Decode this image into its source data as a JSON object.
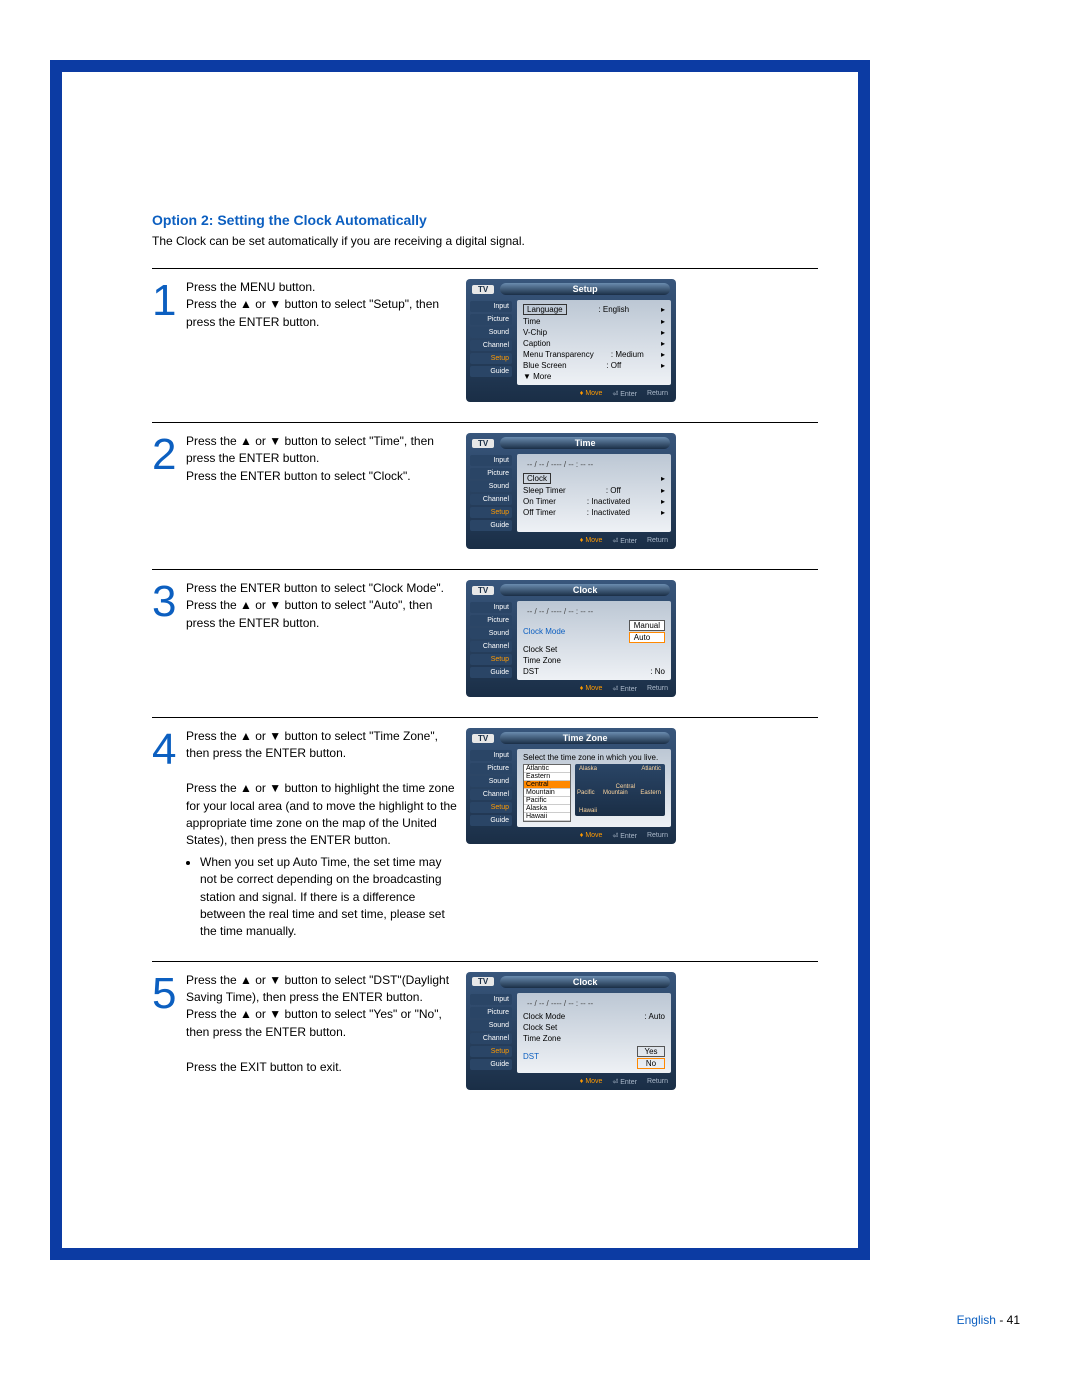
{
  "page": {
    "section_title": "Option 2: Setting the Clock Automatically",
    "intro": "The Clock can be set automatically if you are receiving a digital signal.",
    "footer": {
      "lang": "English",
      "page": "- 41"
    }
  },
  "sidebar_labels": [
    "Input",
    "Picture",
    "Sound",
    "Channel",
    "Setup",
    "Guide"
  ],
  "osd_foot": {
    "move": "Move",
    "enter": "Enter",
    "return": "Return"
  },
  "common": {
    "tv": "TV",
    "time_placeholder": "-- / -- / ---- / -- : -- --"
  },
  "steps": [
    {
      "num": "1",
      "text_parts": [
        "Press the MENU button.",
        "Press the ▲ or ▼ button to select \"Setup\", then press the ENTER button."
      ],
      "osd": {
        "title": "Setup",
        "rows": [
          {
            "label": "Language",
            "value": ": English",
            "boxed": true,
            "arrow": true
          },
          {
            "label": "Time",
            "value": "",
            "arrow": true
          },
          {
            "label": "V-Chip",
            "value": "",
            "arrow": true
          },
          {
            "label": "Caption",
            "value": "",
            "arrow": true
          },
          {
            "label": "Menu Transparency",
            "value": ": Medium",
            "arrow": true
          },
          {
            "label": "Blue Screen",
            "value": ": Off",
            "arrow": true
          },
          {
            "label": "▼ More",
            "value": "",
            "arrow": false
          }
        ]
      }
    },
    {
      "num": "2",
      "text_parts": [
        "Press the ▲ or ▼ button to select \"Time\", then press the ENTER button.",
        "Press the ENTER button to select \"Clock\"."
      ],
      "osd": {
        "title": "Time",
        "timeline": "-- / -- / ---- / -- : -- --",
        "rows": [
          {
            "label": "Clock",
            "value": "",
            "boxed": true,
            "arrow": true
          },
          {
            "label": "Sleep Timer",
            "value": ": Off",
            "arrow": true
          },
          {
            "label": "On Timer",
            "value": ": Inactivated",
            "arrow": true
          },
          {
            "label": "Off Timer",
            "value": ": Inactivated",
            "arrow": true
          }
        ]
      }
    },
    {
      "num": "3",
      "text_parts": [
        "Press the ENTER button to select \"Clock Mode\".",
        "Press the ▲ or ▼ button to select \"Auto\", then press the ENTER button."
      ],
      "osd": {
        "title": "Clock",
        "timeline": "-- / -- / ---- / -- : -- --",
        "clockmode": {
          "label": "Clock Mode",
          "options": [
            "Manual",
            "Auto"
          ],
          "selected": "Auto"
        },
        "extra_rows": [
          {
            "label": "Clock Set",
            "value": ""
          },
          {
            "label": "Time Zone",
            "value": ""
          },
          {
            "label": "DST",
            "value": ": No"
          }
        ]
      }
    },
    {
      "num": "4",
      "text_parts": [
        "Press the ▲ or ▼ button to select \"Time Zone\", then press the ENTER button.",
        "",
        "Press the ▲ or ▼ button to highlight the time zone for your local area (and to move the highlight to the appropriate time zone on the map of the United States), then press the ENTER button."
      ],
      "bullets": [
        "When you set up Auto Time, the set time may not be correct depending on the broadcasting station and signal. If there is a difference between the real time and set time, please set the time manually."
      ],
      "osd": {
        "title": "Time Zone",
        "helper": "Select the time zone in which you live.",
        "tz_options": [
          "Atlantic",
          "Eastern",
          "Central",
          "Mountain",
          "Pacific",
          "Alaska",
          "Hawaii"
        ],
        "tz_selected": "Central",
        "map_labels": [
          "Alaska",
          "Atlantic",
          "Pacific",
          "Mountain",
          "Central",
          "Eastern",
          "Hawaii"
        ]
      }
    },
    {
      "num": "5",
      "text_parts": [
        "Press the ▲ or ▼ button to select \"DST\"(Daylight Saving Time), then press the ENTER button.",
        "Press the ▲ or ▼ button to select \"Yes\" or \"No\", then press the ENTER button.",
        "",
        "Press the EXIT button to exit."
      ],
      "osd": {
        "title": "Clock",
        "timeline": "-- / -- / ---- / -- : -- --",
        "rows": [
          {
            "label": "Clock Mode",
            "value": ": Auto"
          },
          {
            "label": "Clock Set",
            "value": ""
          },
          {
            "label": "Time Zone",
            "value": ""
          }
        ],
        "dst": {
          "label": "DST",
          "options": [
            "Yes",
            "No"
          ],
          "selected": "No"
        }
      }
    }
  ]
}
